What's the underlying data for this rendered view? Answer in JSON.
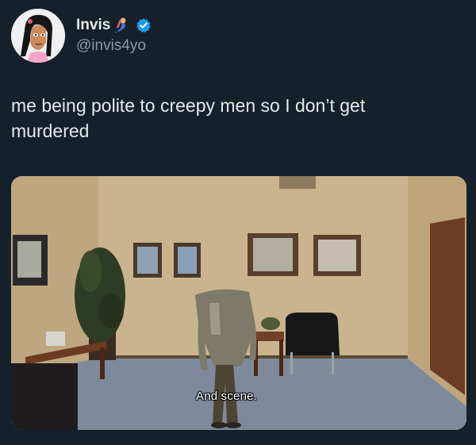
{
  "author": {
    "display_name": "Invis",
    "handle": "@invis4yo",
    "verified": true,
    "name_emoji_icon": "mermaid-icon"
  },
  "tweet": {
    "text_line1": "me being polite to creepy men so I don’t get",
    "text_line2": "murdered"
  },
  "media": {
    "caption": "And scene."
  },
  "colors": {
    "background": "#15202b",
    "text": "#e7e9ea",
    "secondary": "#8b98a5",
    "verified": "#1d9bf0"
  }
}
